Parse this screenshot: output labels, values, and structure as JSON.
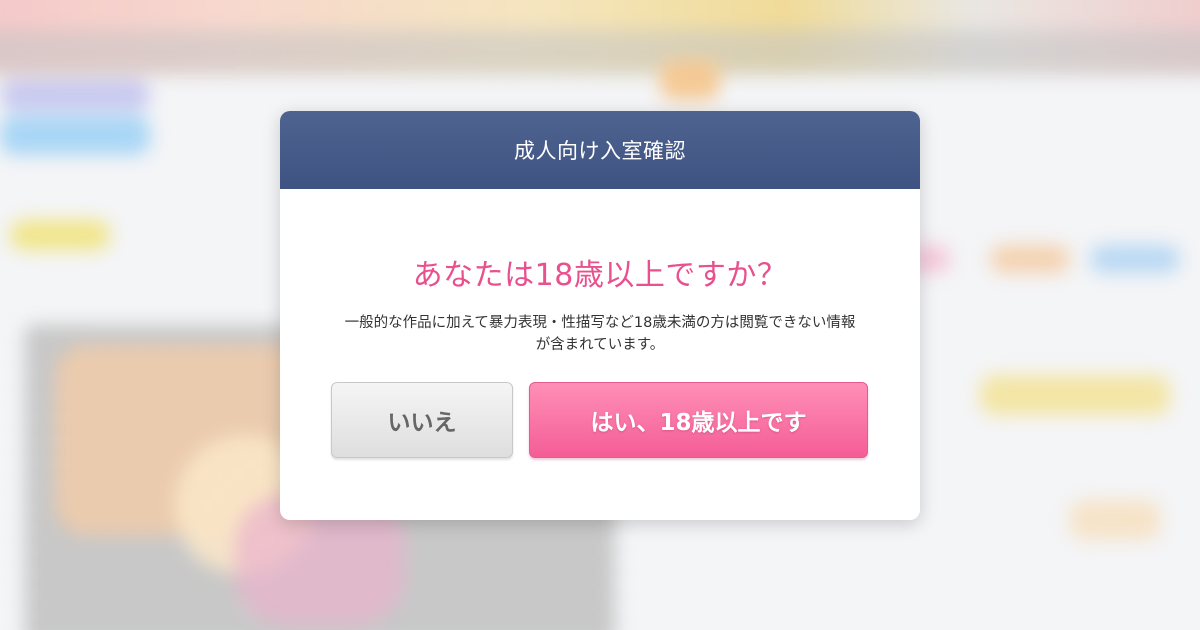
{
  "modal": {
    "title": "成人向け入室確認",
    "question": "あなたは18歳以上ですか？",
    "description_line1": "一般的な作品に加えて暴力表現・性描写など18歳未満の方は閲覧できない情報",
    "description_line2": "が含まれています。",
    "no_button": "いいえ",
    "yes_button": "はい、18歳以上です"
  },
  "colors": {
    "header": "#45598a",
    "question": "#e9508e",
    "yes_button": "#f66fa3",
    "no_button": "#e6e6e6"
  }
}
